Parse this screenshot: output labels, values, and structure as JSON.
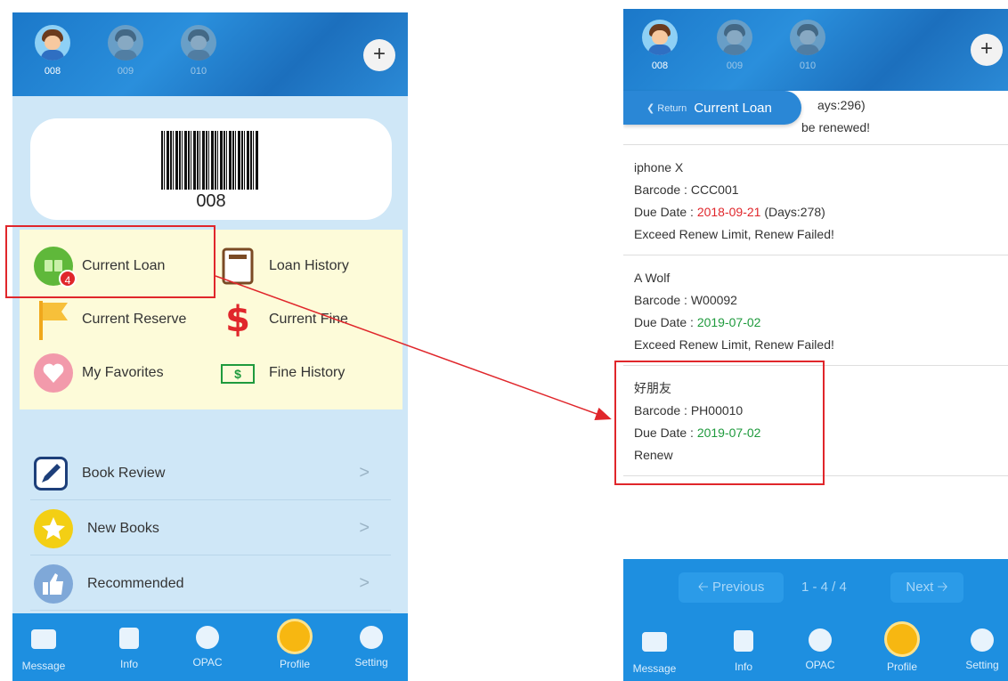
{
  "left": {
    "accounts": [
      {
        "label": "008",
        "active": true
      },
      {
        "label": "009",
        "active": false
      },
      {
        "label": "010",
        "active": false
      }
    ],
    "add_label": "+",
    "barcode_number": "008",
    "grid": {
      "current_loan": "Current Loan",
      "current_loan_badge": "4",
      "loan_history": "Loan History",
      "current_reserve": "Current Reserve",
      "current_fine": "Current Fine",
      "current_fine_symbol": "$",
      "my_favorites": "My Favorites",
      "fine_history": "Fine History",
      "fine_history_symbol": "$"
    },
    "list": [
      {
        "label": "Book Review",
        "icon": "pen-icon"
      },
      {
        "label": "New Books",
        "icon": "star-icon"
      },
      {
        "label": "Recommended",
        "icon": "thumbs-up-icon"
      }
    ],
    "chevron": ">"
  },
  "tabs": [
    {
      "label": "Message",
      "icon": "envelope-icon"
    },
    {
      "label": "Info",
      "icon": "info-icon"
    },
    {
      "label": "OPAC",
      "icon": "search-icon"
    },
    {
      "label": "Profile",
      "icon": "profile-icon"
    },
    {
      "label": "Setting",
      "icon": "setting-icon"
    }
  ],
  "right": {
    "return_label": "Return",
    "title": "Current Loan",
    "partial_days": "ays:296)",
    "partial_status": "be renewed!",
    "loans": [
      {
        "title": "iphone X",
        "barcode_prefix": "Barcode : ",
        "barcode": "CCC001",
        "due_prefix": "Due Date : ",
        "due_date": "2018-09-21",
        "due_color": "red",
        "days": " (Days:278)",
        "status": "Exceed Renew Limit, Renew Failed!"
      },
      {
        "title": "A Wolf",
        "barcode_prefix": "Barcode : ",
        "barcode": "W00092",
        "due_prefix": "Due Date : ",
        "due_date": "2019-07-02",
        "due_color": "green",
        "days": "",
        "status": "Exceed Renew Limit, Renew Failed!"
      },
      {
        "title": "好朋友",
        "barcode_prefix": "Barcode : ",
        "barcode": "PH00010",
        "due_prefix": "Due Date : ",
        "due_date": "2019-07-02",
        "due_color": "green",
        "days": "",
        "status": "Renew"
      }
    ],
    "pager": {
      "previous": "Previous",
      "info": "1 - 4 / 4",
      "next": "Next"
    }
  },
  "colors": {
    "header_blue": "#1e8fe0",
    "panel_bg": "#cfe7f7",
    "grid_bg": "#fdfbd9",
    "highlight_red": "#e0262b",
    "due_red": "#e0262b",
    "due_green": "#1f9a3d"
  }
}
